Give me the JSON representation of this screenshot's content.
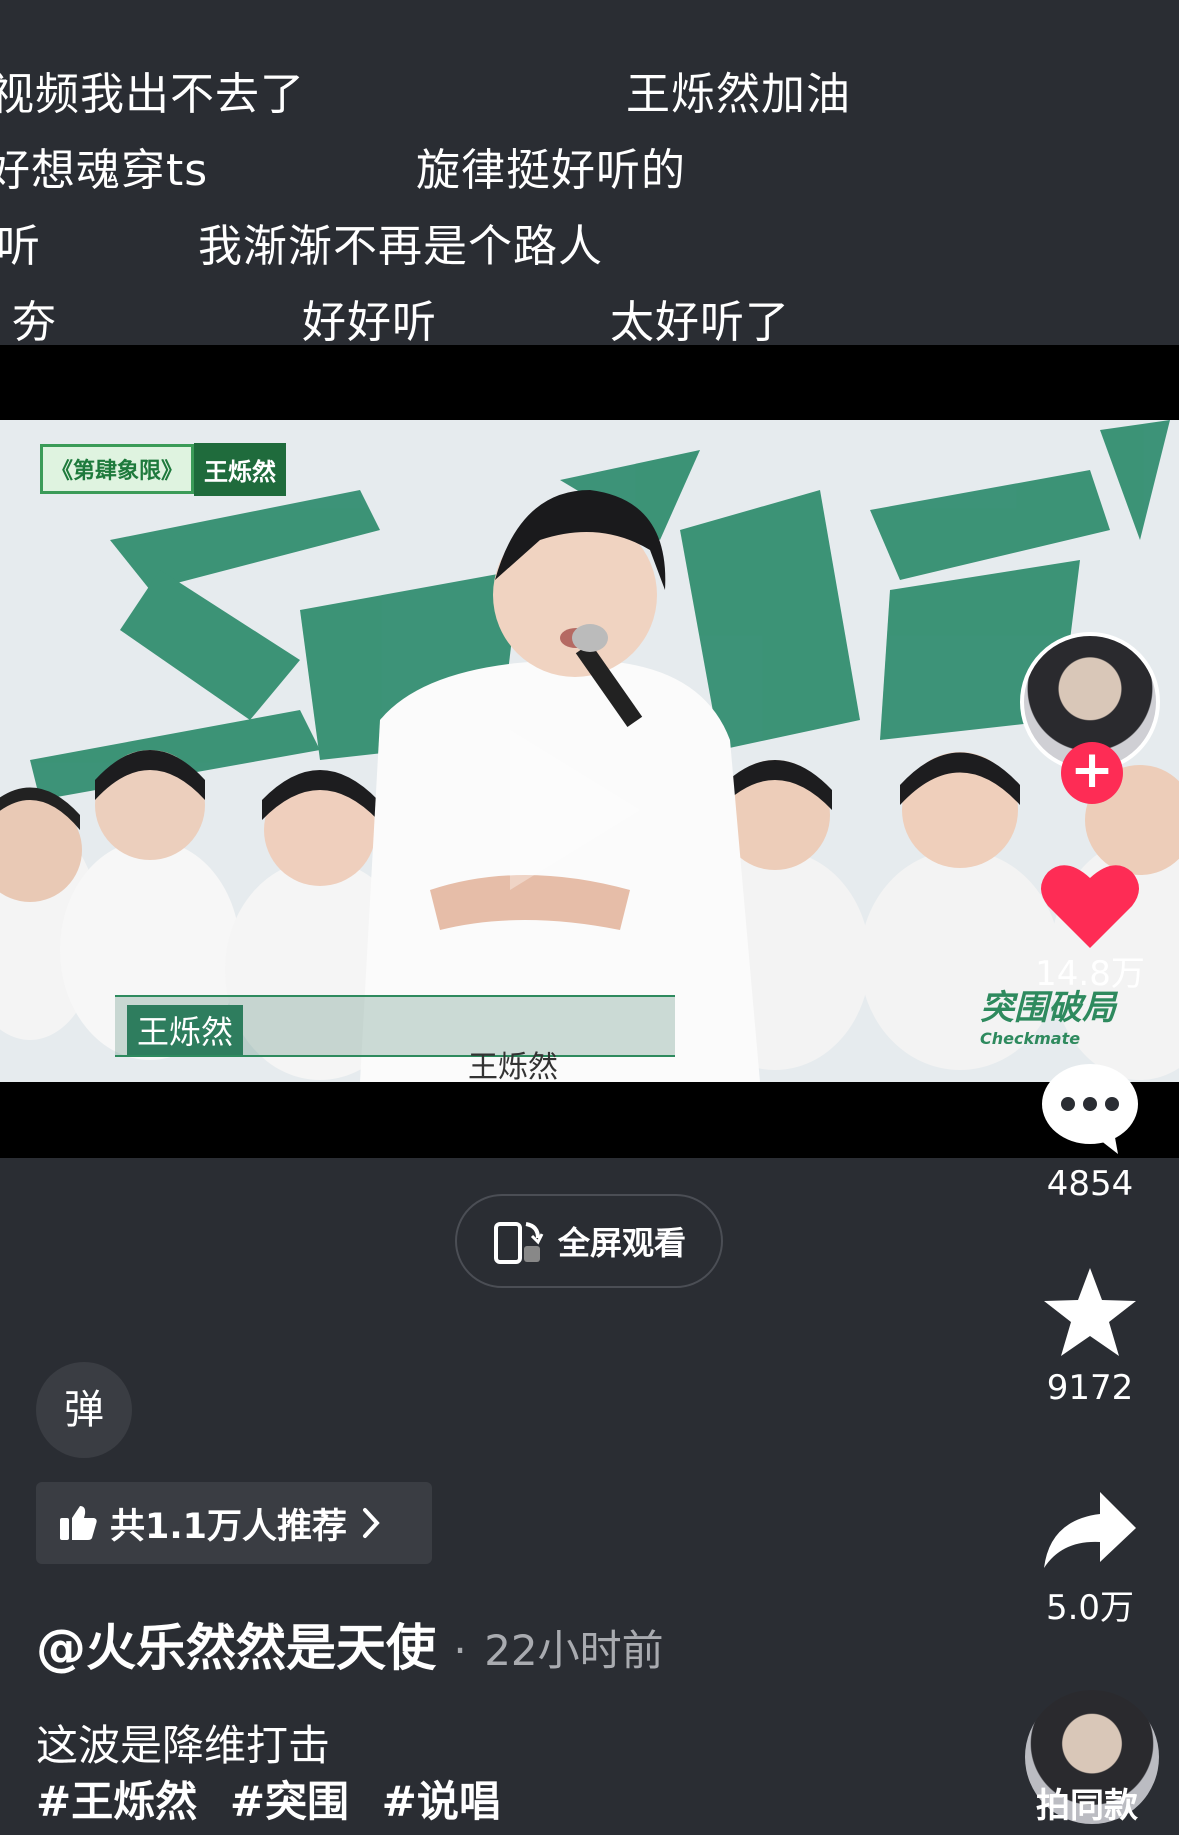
{
  "danmaku": [
    "视频我出不去了",
    "王烁然加油",
    "好想魂穿ts",
    "旋律挺好听的",
    "听",
    "我渐渐不再是个路人",
    "夯",
    "好好听",
    "太好听了"
  ],
  "video": {
    "show_tag": "《第肆象限》",
    "show_tag_name": "王烁然",
    "lower_third_name": "王烁然",
    "subtitle": "王烁然",
    "corner_logo": "突围破局",
    "corner_logo_sub": "Checkmate"
  },
  "actions": {
    "like_count": "14.8万",
    "comment_count": "4854",
    "favorite_count": "9172",
    "share_count": "5.0万"
  },
  "fullscreen_label": "全屏观看",
  "danmaku_toggle": "弹",
  "recommend_label": "共1.1万人推荐",
  "author": "@火乐然然是天使",
  "time_sep": "·",
  "post_time": "22小时前",
  "caption": "这波是降维打击",
  "hashtags": [
    "#王烁然",
    "#突围",
    "#说唱"
  ],
  "music_label": "拍同款",
  "colors": {
    "background": "#2a2d33",
    "like": "#fe2c55",
    "brand_green": "#1f6b3c"
  }
}
